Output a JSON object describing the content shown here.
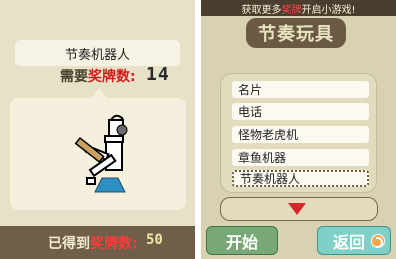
{
  "left": {
    "robot_name": "节奏机器人",
    "need_prefix": "需要",
    "need_label": "奖牌数:",
    "need_value": "14",
    "got_prefix": "已得到",
    "got_label": "奖牌数:",
    "got_value": "50"
  },
  "right": {
    "top_text_prefix": "获取更多",
    "top_text_highlight": "奖牌",
    "top_text_suffix": "开启小游戏!",
    "banner": "节奏玩具",
    "items": [
      "名片",
      "电话",
      "怪物老虎机",
      "章鱼机器",
      "节奏机器人"
    ],
    "selected_index": 4,
    "start_label": "开始",
    "back_label": "返回"
  },
  "colors": {
    "accent_red": "#d31d1d",
    "start_green": "#78a878",
    "back_teal": "#7fd1c7"
  }
}
